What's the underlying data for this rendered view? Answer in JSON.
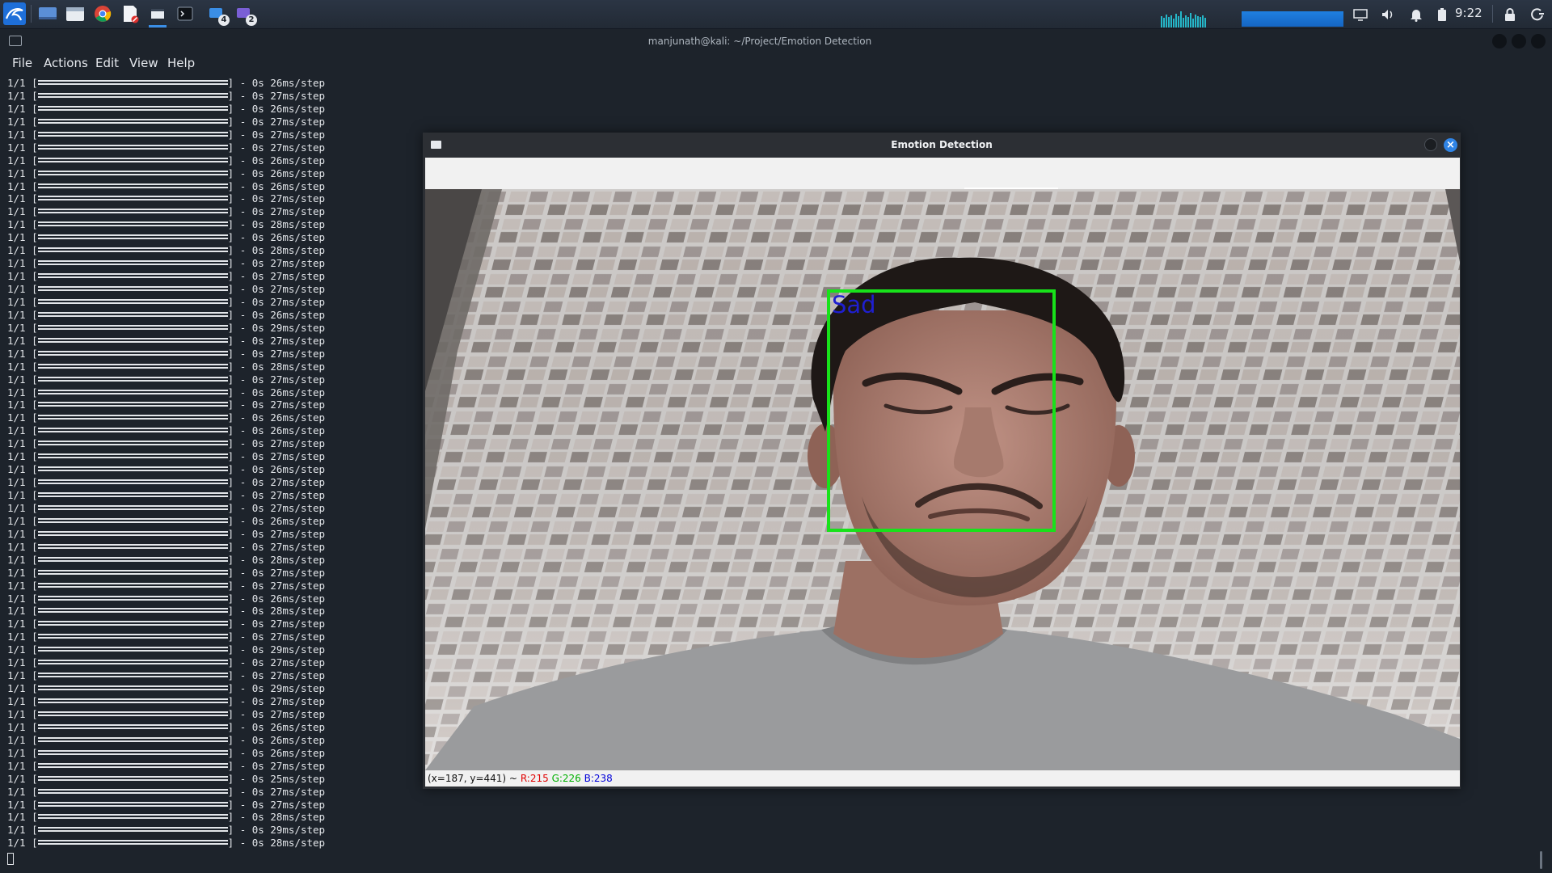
{
  "taskbar": {
    "badges": {
      "ws1": "4",
      "ws2": "2"
    },
    "clock": "9:22",
    "accent_color": "#1e6fd9"
  },
  "terminal": {
    "title": "manjunath@kali: ~/Project/Emotion Detection",
    "menu": {
      "file": "File",
      "actions": "Actions",
      "edit": "Edit",
      "view": "View",
      "help": "Help"
    },
    "log_prefix": "1/1 [",
    "log_mid": "] - 0s ",
    "log_times": [
      "26ms/step",
      "27ms/step",
      "26ms/step",
      "27ms/step",
      "27ms/step",
      "27ms/step",
      "26ms/step",
      "26ms/step",
      "26ms/step",
      "27ms/step",
      "27ms/step",
      "28ms/step",
      "26ms/step",
      "28ms/step",
      "27ms/step",
      "27ms/step",
      "27ms/step",
      "27ms/step",
      "26ms/step",
      "29ms/step",
      "27ms/step",
      "27ms/step",
      "28ms/step",
      "27ms/step",
      "26ms/step",
      "27ms/step",
      "26ms/step",
      "26ms/step",
      "27ms/step",
      "27ms/step",
      "26ms/step",
      "27ms/step",
      "27ms/step",
      "27ms/step",
      "26ms/step",
      "27ms/step",
      "27ms/step",
      "28ms/step",
      "27ms/step",
      "27ms/step",
      "26ms/step",
      "28ms/step",
      "27ms/step",
      "27ms/step",
      "29ms/step",
      "27ms/step",
      "27ms/step",
      "29ms/step",
      "27ms/step",
      "27ms/step",
      "26ms/step",
      "26ms/step",
      "26ms/step",
      "27ms/step",
      "25ms/step",
      "27ms/step",
      "27ms/step",
      "28ms/step",
      "29ms/step",
      "28ms/step"
    ]
  },
  "emotion_window": {
    "title": "Emotion Detection",
    "close_glyph": "×",
    "detection_label": "Sad",
    "box_color": "#18e21a",
    "label_color": "#1f1fd0",
    "status": {
      "coords": "(x=187, y=441) ~",
      "r": "R:215",
      "g": "G:226",
      "b": "B:238"
    }
  }
}
